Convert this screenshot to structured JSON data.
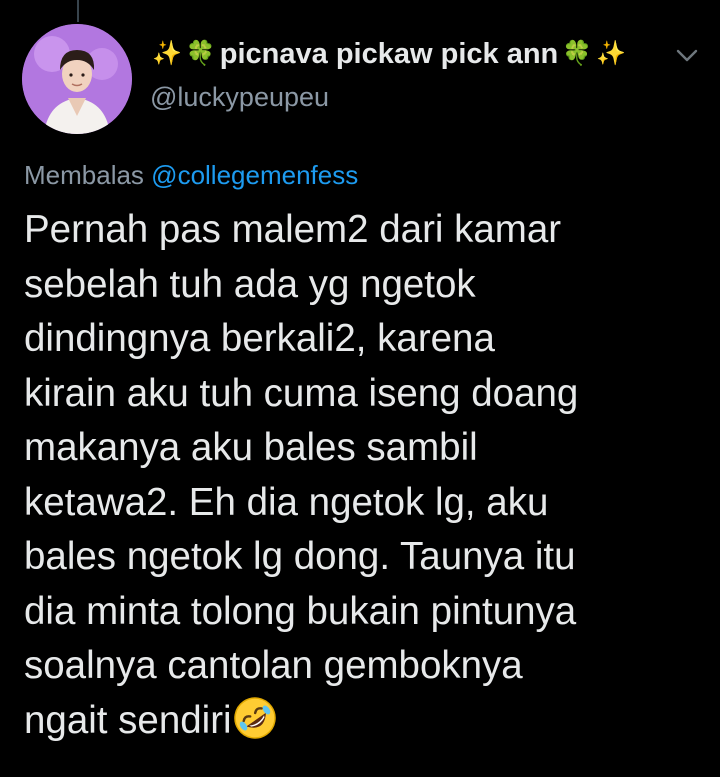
{
  "tweet": {
    "display_name": "picnava pickaw pick ann",
    "handle": "@luckypeupeu",
    "reply_prefix": "Membalas",
    "reply_to": "@collegemenfess",
    "body": "Pernah pas malem2 dari kamar\nsebelah tuh ada yg ngetok\ndindingnya berkali2, karena\nkirain aku tuh cuma iseng doang\nmakanya aku bales sambil\nketawa2. Eh dia ngetok lg, aku\nbales ngetok lg dong. Taunya itu\ndia minta tolong bukain pintunya\nsoalnya cantolan gemboknya\nngait sendiri",
    "trailing_emoji": "rolling-on-floor-laughing",
    "name_decorations": [
      "sparkles",
      "four-leaf-clover",
      "four-leaf-clover",
      "sparkles"
    ]
  },
  "colors": {
    "background": "#000000",
    "text_primary": "#e7e9ea",
    "text_secondary": "#8b98a5",
    "link": "#1d9bf0",
    "avatar_bg": "#b277e0"
  },
  "icons": {
    "more": "chevron-down-icon",
    "avatar": "avatar"
  }
}
